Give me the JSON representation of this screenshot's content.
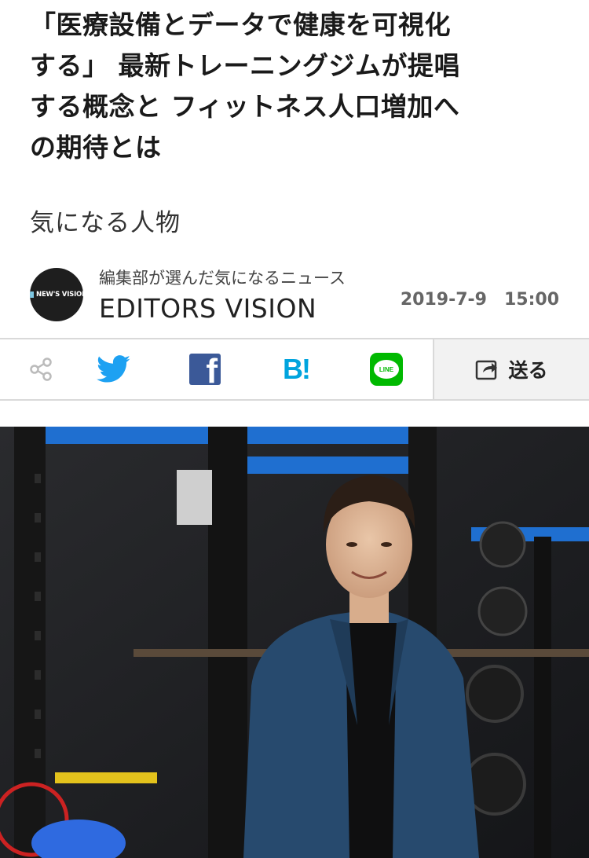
{
  "article": {
    "headline_lines": [
      "「医療設備とデータで健康を可視化",
      "する」 最新トレーニングジムが提唱",
      "する概念と フィットネス人口増加へ",
      "の期待とは"
    ],
    "category": "気になる人物"
  },
  "author": {
    "avatar_logo_text": "NEW'S VISION",
    "tagline": "編集部が選んだ気になるニュース",
    "name": "EDITORS VISION",
    "date": "2019-7-9　15:00"
  },
  "share": {
    "icons": [
      "share-icon",
      "twitter-icon",
      "facebook-icon",
      "hatena-bookmark-icon",
      "line-icon"
    ],
    "facebook_glyph": "f",
    "hatena_glyph": "B!",
    "line_glyph": "LINE",
    "send_label": "送る"
  },
  "colors": {
    "twitter": "#1da1f2",
    "facebook": "#3b5998",
    "hatena": "#00a4de",
    "line": "#00b900",
    "gym_blue": "#1f6fd0"
  }
}
